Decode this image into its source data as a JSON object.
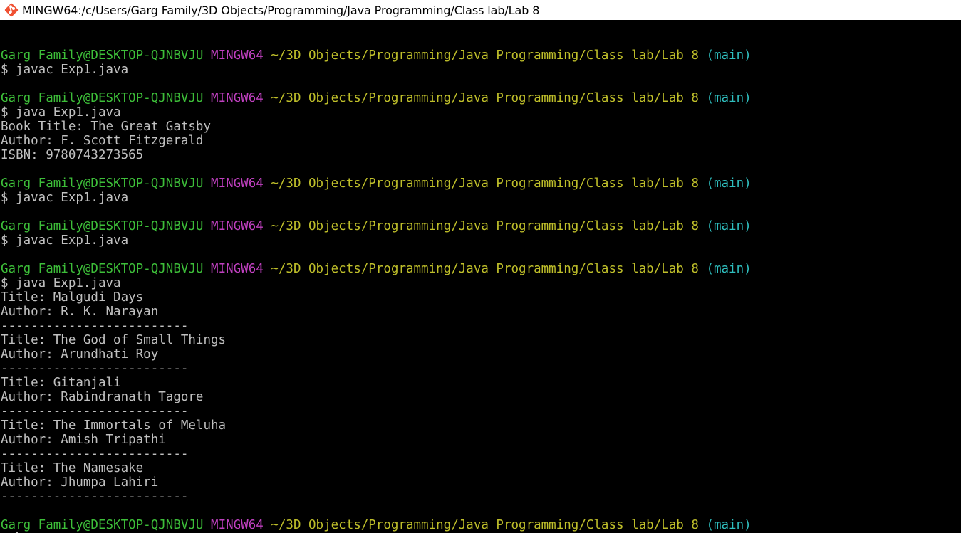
{
  "window": {
    "title": "MINGW64:/c/Users/Garg Family/3D Objects/Programming/Java Programming/Class lab/Lab 8",
    "icon": "git-bash-icon"
  },
  "colors": {
    "background": "#000000",
    "foreground": "#c0c0c0",
    "user_host": "#3dbe39",
    "mingw": "#bf40bf",
    "path": "#bfbf2a",
    "branch": "#2fbfbf"
  },
  "prompt": {
    "user_host": "Garg Family@DESKTOP-QJNBVJU",
    "shell": "MINGW64",
    "path": "~/3D Objects/Programming/Java Programming/Class lab/Lab 8",
    "branch": "(main)"
  },
  "lines": [
    {
      "type": "blank",
      "text": ""
    },
    {
      "type": "prompt"
    },
    {
      "type": "command",
      "text": "$ javac Exp1.java"
    },
    {
      "type": "blank",
      "text": ""
    },
    {
      "type": "prompt"
    },
    {
      "type": "command",
      "text": "$ java Exp1.java"
    },
    {
      "type": "output",
      "text": "Book Title: The Great Gatsby"
    },
    {
      "type": "output",
      "text": "Author: F. Scott Fitzgerald"
    },
    {
      "type": "output",
      "text": "ISBN: 9780743273565"
    },
    {
      "type": "blank",
      "text": ""
    },
    {
      "type": "prompt"
    },
    {
      "type": "command",
      "text": "$ javac Exp1.java"
    },
    {
      "type": "blank",
      "text": ""
    },
    {
      "type": "prompt"
    },
    {
      "type": "command",
      "text": "$ javac Exp1.java"
    },
    {
      "type": "blank",
      "text": ""
    },
    {
      "type": "prompt"
    },
    {
      "type": "command",
      "text": "$ java Exp1.java"
    },
    {
      "type": "output",
      "text": "Title: Malgudi Days"
    },
    {
      "type": "output",
      "text": "Author: R. K. Narayan"
    },
    {
      "type": "output",
      "text": "-------------------------"
    },
    {
      "type": "output",
      "text": "Title: The God of Small Things"
    },
    {
      "type": "output",
      "text": "Author: Arundhati Roy"
    },
    {
      "type": "output",
      "text": "-------------------------"
    },
    {
      "type": "output",
      "text": "Title: Gitanjali"
    },
    {
      "type": "output",
      "text": "Author: Rabindranath Tagore"
    },
    {
      "type": "output",
      "text": "-------------------------"
    },
    {
      "type": "output",
      "text": "Title: The Immortals of Meluha"
    },
    {
      "type": "output",
      "text": "Author: Amish Tripathi"
    },
    {
      "type": "output",
      "text": "-------------------------"
    },
    {
      "type": "output",
      "text": "Title: The Namesake"
    },
    {
      "type": "output",
      "text": "Author: Jhumpa Lahiri"
    },
    {
      "type": "output",
      "text": "-------------------------"
    },
    {
      "type": "blank",
      "text": ""
    },
    {
      "type": "prompt"
    },
    {
      "type": "input",
      "text": "$ "
    }
  ]
}
